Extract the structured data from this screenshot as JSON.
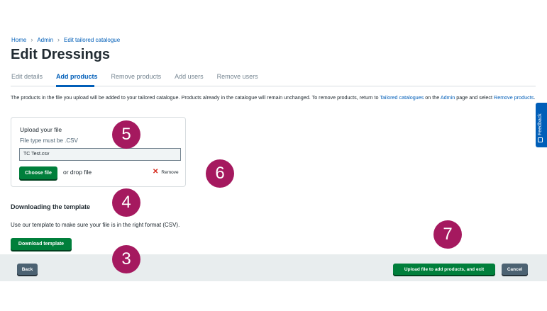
{
  "breadcrumb": [
    "Home",
    "Admin",
    "Edit tailored catalogue"
  ],
  "page_title": "Edit Dressings",
  "tabs": [
    {
      "label": "Edit details",
      "active": false
    },
    {
      "label": "Add products",
      "active": true
    },
    {
      "label": "Remove products",
      "active": false
    },
    {
      "label": "Add users",
      "active": false
    },
    {
      "label": "Remove users",
      "active": false
    }
  ],
  "description": {
    "part1": "The products in the file you upload will be added to your tailored catalogue. Products already in the catalogue will remain unchanged. To remove products, return to ",
    "link1": "Tailored catalogues",
    "part2": " on the ",
    "link2": "Admin",
    "part3": " page and select ",
    "link3": "Remove products",
    "part4": "."
  },
  "upload": {
    "heading": "Upload your file",
    "hint": "File type must be .CSV",
    "file_value": "TC Test.csv",
    "choose_label": "Choose file",
    "drop_label": "or drop file",
    "remove_label": "Remove"
  },
  "download": {
    "heading": "Downloading the template",
    "text": "Use our template to make sure your file is in the right format (CSV).",
    "button_label": "Download template"
  },
  "footer": {
    "back_label": "Back",
    "upload_label": "Upload file to add products, and exit",
    "cancel_label": "Cancel"
  },
  "feedback_label": "Feedback",
  "markers": [
    "5",
    "6",
    "4",
    "7",
    "3"
  ],
  "colors": {
    "primary_blue": "#005eb8",
    "green": "#007f3b",
    "secondary_grey": "#4c6272",
    "marker_magenta": "#a5195f",
    "footer_bg": "#e8edee"
  }
}
